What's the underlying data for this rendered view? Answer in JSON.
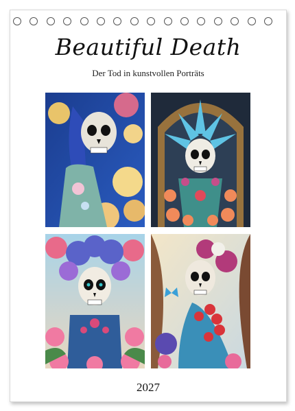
{
  "calendar": {
    "title": "Beautiful Death",
    "subtitle": "Der Tod in kunstvollen Porträts",
    "year": "2027"
  },
  "photos": [
    {
      "name": "skull-portrait-blue-roses"
    },
    {
      "name": "skull-portrait-blue-feathers"
    },
    {
      "name": "skull-portrait-pink-flowers"
    },
    {
      "name": "skull-portrait-butterfly"
    }
  ],
  "colors": {
    "ring": "#555555",
    "text": "#111111"
  }
}
